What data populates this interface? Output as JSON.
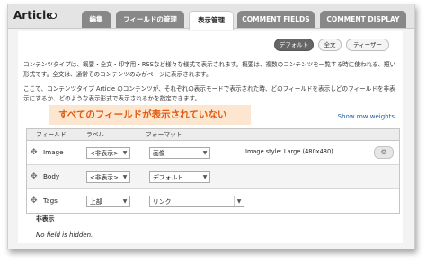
{
  "header": {
    "title": "Article",
    "tabs": [
      {
        "label": "編集"
      },
      {
        "label": "フィールドの管理"
      },
      {
        "label": "表示管理"
      },
      {
        "label": "COMMENT FIELDS"
      },
      {
        "label": "COMMENT DISPLAY"
      }
    ]
  },
  "view_modes": [
    {
      "label": "デフォルト"
    },
    {
      "label": "全文"
    },
    {
      "label": "ティーザー"
    }
  ],
  "description": {
    "p1_line1": "コンテンツタイプは、概要・全文・印字用・RSSなど様々な様式で表示されます。概要は、複数のコンテンツを一覧する時に使われる、短い",
    "p1_line2": "形式です。全文は、通常そのコンテンツのみがページに表示されます。",
    "p2_line1": "ここで、コンテンツタイプ Article のコンテンツが、それぞれの表示モードで表示された時、どのフィールドを表示しどのフィールドを非表",
    "p2_line2": "示にするか、どのような表示形式で表示されるかを指定できます。"
  },
  "banner": "すべてのフィールドが表示されていない",
  "show_row_weights": "Show row weights",
  "table": {
    "headers": {
      "field": "フィールド",
      "label": "ラベル",
      "format": "フォーマット"
    },
    "rows": [
      {
        "field": "Image",
        "label": "<非表示>",
        "format": "画像",
        "summary": "Image style: Large (480x480)"
      },
      {
        "field": "Body",
        "label": "<非表示>",
        "format": "デフォルト"
      },
      {
        "field": "Tags",
        "label": "上部",
        "format": "リンク"
      }
    ]
  },
  "hidden_section": {
    "heading": "非表示",
    "empty_text": "No field is hidden."
  }
}
